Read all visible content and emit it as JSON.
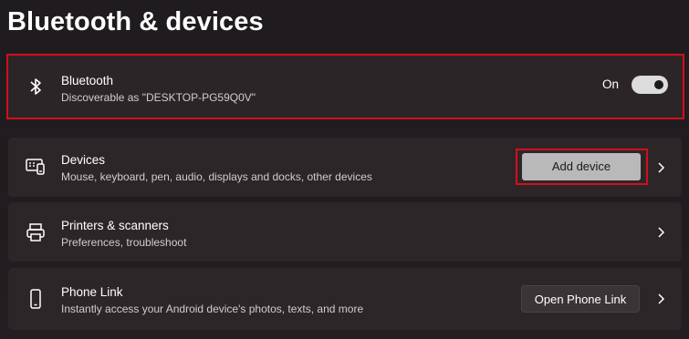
{
  "page_title": "Bluetooth & devices",
  "bluetooth": {
    "title": "Bluetooth",
    "subtitle": "Discoverable as \"DESKTOP-PG59Q0V\"",
    "toggle_label": "On",
    "toggle_state": "on",
    "icon": "bluetooth-icon"
  },
  "devices": {
    "title": "Devices",
    "subtitle": "Mouse, keyboard, pen, audio, displays and docks, other devices",
    "button_label": "Add device",
    "icon": "devices-icon"
  },
  "printers": {
    "title": "Printers & scanners",
    "subtitle": "Preferences, troubleshoot",
    "icon": "printer-icon"
  },
  "phone_link": {
    "title": "Phone Link",
    "subtitle": "Instantly access your Android device's photos, texts, and more",
    "button_label": "Open Phone Link",
    "icon": "phone-icon"
  },
  "colors": {
    "highlight": "#d0101a",
    "card_bg": "#2c2629",
    "toggle_on": "#dcdcdc"
  }
}
